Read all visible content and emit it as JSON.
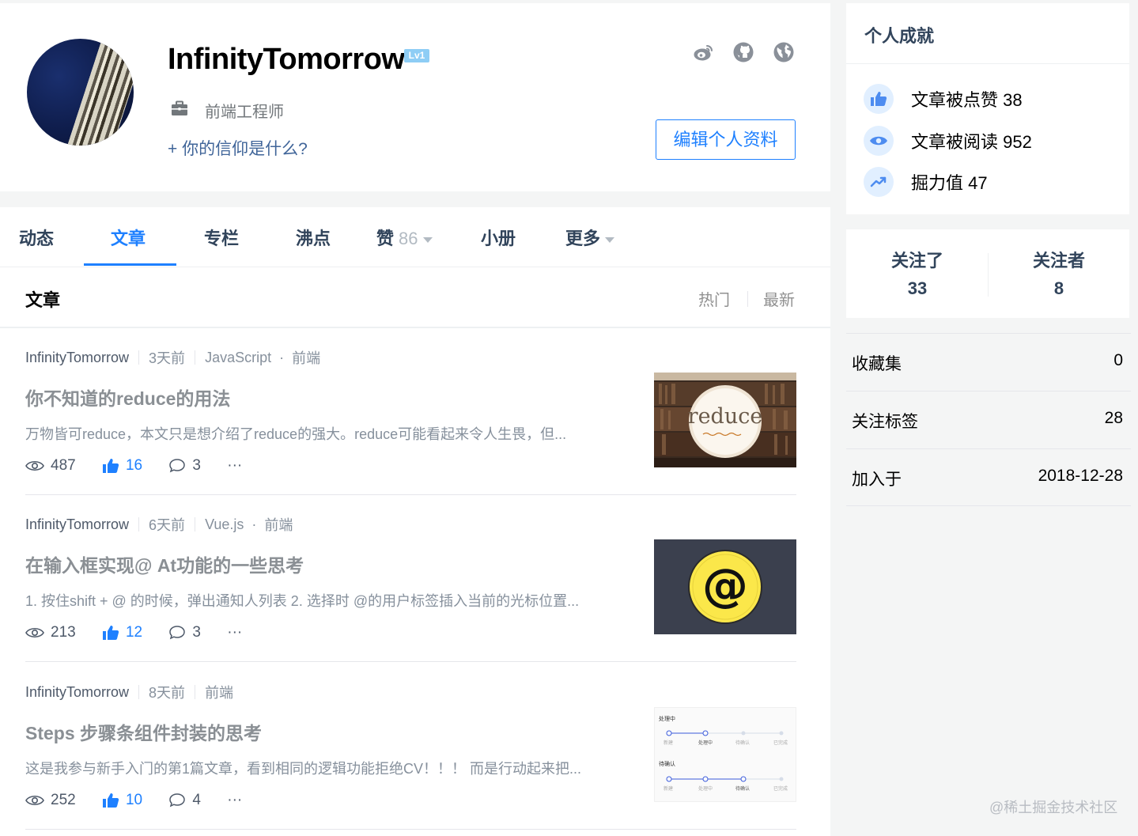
{
  "profile": {
    "username": "InfinityTomorrow",
    "level_badge": "Lv1",
    "job_title": "前端工程师",
    "belief_prompt": "+ 你的信仰是什么?",
    "edit_button": "编辑个人资料",
    "social_icons": [
      "weibo-icon",
      "github-icon",
      "globe-icon"
    ]
  },
  "tabs": [
    {
      "label": "动态"
    },
    {
      "label": "文章",
      "active": true
    },
    {
      "label": "专栏"
    },
    {
      "label": "沸点"
    },
    {
      "label": "赞",
      "count": "86",
      "dropdown": true
    },
    {
      "label": "小册"
    },
    {
      "label": "更多",
      "dropdown": true
    }
  ],
  "list_header": {
    "title": "文章",
    "sort_hot": "热门",
    "sort_new": "最新"
  },
  "articles": [
    {
      "author": "InfinityTomorrow",
      "time": "3天前",
      "tag1": "JavaScript",
      "tag2": "前端",
      "title": "你不知道的reduce的用法",
      "abstract": "万物皆可reduce，本文只是想介绍了reduce的强大。reduce可能看起来令人生畏，但...",
      "views": "487",
      "likes": "16",
      "comments": "3",
      "thumb_text": "reduce"
    },
    {
      "author": "InfinityTomorrow",
      "time": "6天前",
      "tag1": "Vue.js",
      "tag2": "前端",
      "title": "在输入框实现@ At功能的一些思考",
      "abstract": "1. 按住shift + @ 的时候，弹出通知人列表 2. 选择时 @的用户标签插入当前的光标位置...",
      "views": "213",
      "likes": "12",
      "comments": "3",
      "thumb_text": "@"
    },
    {
      "author": "InfinityTomorrow",
      "time": "8天前",
      "tag1": "前端",
      "title": "Steps 步骤条组件封装的思考",
      "abstract": "这是我参与新手入门的第1篇文章，看到相同的逻辑功能拒绝CV！！！ 而是行动起来把...",
      "views": "252",
      "likes": "10",
      "comments": "4",
      "thumb_labels": {
        "row1_title": "处理中",
        "row2_title": "待确认",
        "steps": [
          "新建",
          "处理中",
          "待确认",
          "已完成"
        ]
      }
    }
  ],
  "achievements": {
    "title": "个人成就",
    "items": [
      {
        "label": "文章被点赞 38",
        "icon": "thumbs-up-icon"
      },
      {
        "label": "文章被阅读 952",
        "icon": "eye-icon"
      },
      {
        "label": "掘力值 47",
        "icon": "trend-icon"
      }
    ]
  },
  "follow": {
    "following_label": "关注了",
    "following": "33",
    "followers_label": "关注者",
    "followers": "8"
  },
  "info": [
    {
      "label": "收藏集",
      "value": "0"
    },
    {
      "label": "关注标签",
      "value": "28"
    },
    {
      "label": "加入于",
      "value": "2018-12-28"
    }
  ],
  "watermark": "@稀土掘金技术社区",
  "colors": {
    "accent": "#1e80ff",
    "title_gray": "#8a8f94",
    "belief_blue": "#406599"
  }
}
